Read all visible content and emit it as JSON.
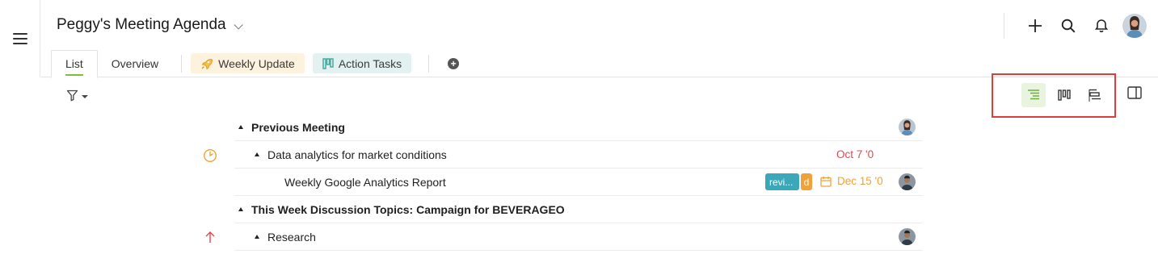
{
  "header": {
    "title": "Peggy's Meeting Agenda"
  },
  "tabs": [
    {
      "label": "List"
    },
    {
      "label": "Overview"
    },
    {
      "label": "Weekly Update"
    },
    {
      "label": "Action Tasks"
    }
  ],
  "icons": {
    "menu": "hamburger-icon",
    "add": "plus-icon",
    "search": "search-icon",
    "notifications": "bell-icon",
    "filter": "funnel-icon",
    "list_view": "list-view-icon",
    "board_view": "board-view-icon",
    "gantt_view": "gantt-view-icon",
    "side_panel": "side-panel-icon"
  },
  "colors": {
    "active_tab_underline": "#7cbf3a",
    "highlight_box": "#e23b3b",
    "overdue": "#e04848",
    "due_soon": "#f0a23a",
    "tag_review": "#3aa8b8"
  },
  "tasks": [
    {
      "title": "Previous Meeting",
      "type": "section",
      "collapsible": true
    },
    {
      "title": "Data analytics for market conditions",
      "type": "task",
      "collapsible": true,
      "due": "Oct 7 '0",
      "status_icon": "clock-icon"
    },
    {
      "title": "Weekly Google Analytics Report",
      "type": "subtask",
      "tags": [
        "revi...",
        "d"
      ],
      "due": "Dec 15 '0"
    },
    {
      "title": "This Week Discussion Topics: Campaign for BEVERAGEO",
      "type": "section",
      "collapsible": true
    },
    {
      "title": "Research",
      "type": "task",
      "collapsible": true,
      "priority_icon": "arrow-up-icon"
    }
  ]
}
